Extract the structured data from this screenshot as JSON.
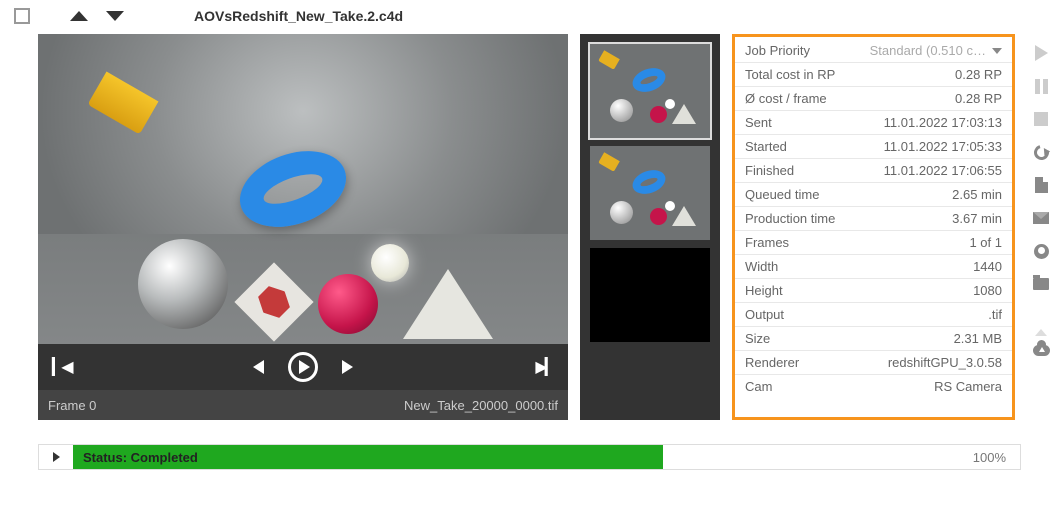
{
  "header": {
    "title": "AOVsRedshift_New_Take.2.c4d"
  },
  "preview": {
    "frame_label": "Frame 0",
    "file_label": "New_Take_20000_0000.tif"
  },
  "details": [
    {
      "k": "Job Priority",
      "v": "Standard (0.510 c…",
      "dropdown": true
    },
    {
      "k": "Total cost in RP",
      "v": "0.28 RP"
    },
    {
      "k": "Ø cost / frame",
      "v": "0.28 RP"
    },
    {
      "k": "Sent",
      "v": "11.01.2022 17:03:13"
    },
    {
      "k": "Started",
      "v": "11.01.2022 17:05:33"
    },
    {
      "k": "Finished",
      "v": "11.01.2022 17:06:55"
    },
    {
      "k": "Queued time",
      "v": "2.65 min"
    },
    {
      "k": "Production time",
      "v": "3.67 min"
    },
    {
      "k": "Frames",
      "v": "1 of 1"
    },
    {
      "k": "Width",
      "v": "1440"
    },
    {
      "k": "Height",
      "v": "1080"
    },
    {
      "k": "Output",
      "v": ".tif"
    },
    {
      "k": "Size",
      "v": "2.31 MB"
    },
    {
      "k": "Renderer",
      "v": "redshiftGPU_3.0.58"
    },
    {
      "k": "Cam",
      "v": "RS Camera"
    }
  ],
  "status": {
    "label": "Status: Completed",
    "percent": "100%"
  }
}
